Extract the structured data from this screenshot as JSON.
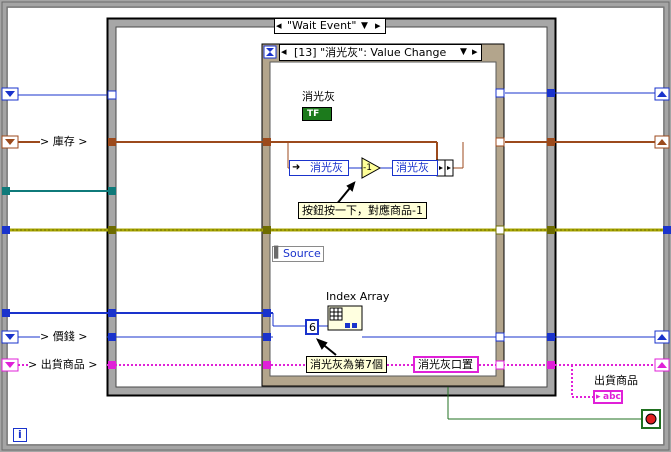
{
  "outer_frame": {
    "color": "#9c9c9c"
  },
  "while_loop": {
    "iteration_icon": "i"
  },
  "event_structure": {
    "selector_label": "\"Wait Event\"",
    "case_label": "[13] \"消光灰\": Value Change",
    "timeout_icon": "hourglass-icon"
  },
  "controls": {
    "bool_label": "消光灰",
    "bool_value": "TF",
    "source_label": "Source",
    "index_array_label": "Index Array",
    "const_value": "6",
    "minus_one": "-1",
    "case_tunnel_left": "消光灰",
    "case_tunnel_right": "消光灰",
    "ship_string_label": "消光灰口置"
  },
  "shift_registers": {
    "inventory": "> 庫存 >",
    "price": "> 價錢 >",
    "shipped": "> 出貨商品 >"
  },
  "indicator": {
    "label": "出貨商品",
    "type": "abc"
  },
  "notes": {
    "press_button": "按鈕按一下，對應商品-1",
    "index_seven": "消光灰為第7個"
  },
  "colors": {
    "brown_wire": "#9c4a1c",
    "blue_wire": "#1a33cc",
    "teal_wire": "#0f7a7a",
    "olive_wire": "#a8a600",
    "pink_wire": "#e020d8",
    "green_wire": "#207020",
    "frame_gray": "#a5a5a5"
  }
}
